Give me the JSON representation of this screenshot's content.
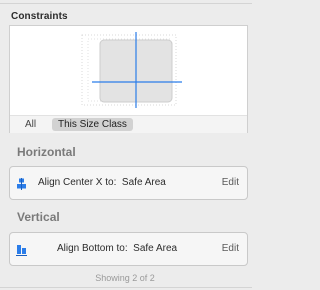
{
  "inspector": {
    "section_title": "Constraints",
    "filter": {
      "all_label": "All",
      "size_class_label": "This Size Class"
    },
    "groups": [
      {
        "label": "Horizontal",
        "constraint": {
          "icon": "align-center-x-icon",
          "text": "Align Center X to:  Safe Area",
          "edit_label": "Edit"
        }
      },
      {
        "label": "Vertical",
        "constraint": {
          "icon": "align-bottom-icon",
          "text": "Align Bottom to:  Safe Area",
          "edit_label": "Edit"
        }
      }
    ],
    "footer": "Showing 2 of 2"
  },
  "colors": {
    "accent": "#2b7de9",
    "panel_bg": "#ececec"
  }
}
